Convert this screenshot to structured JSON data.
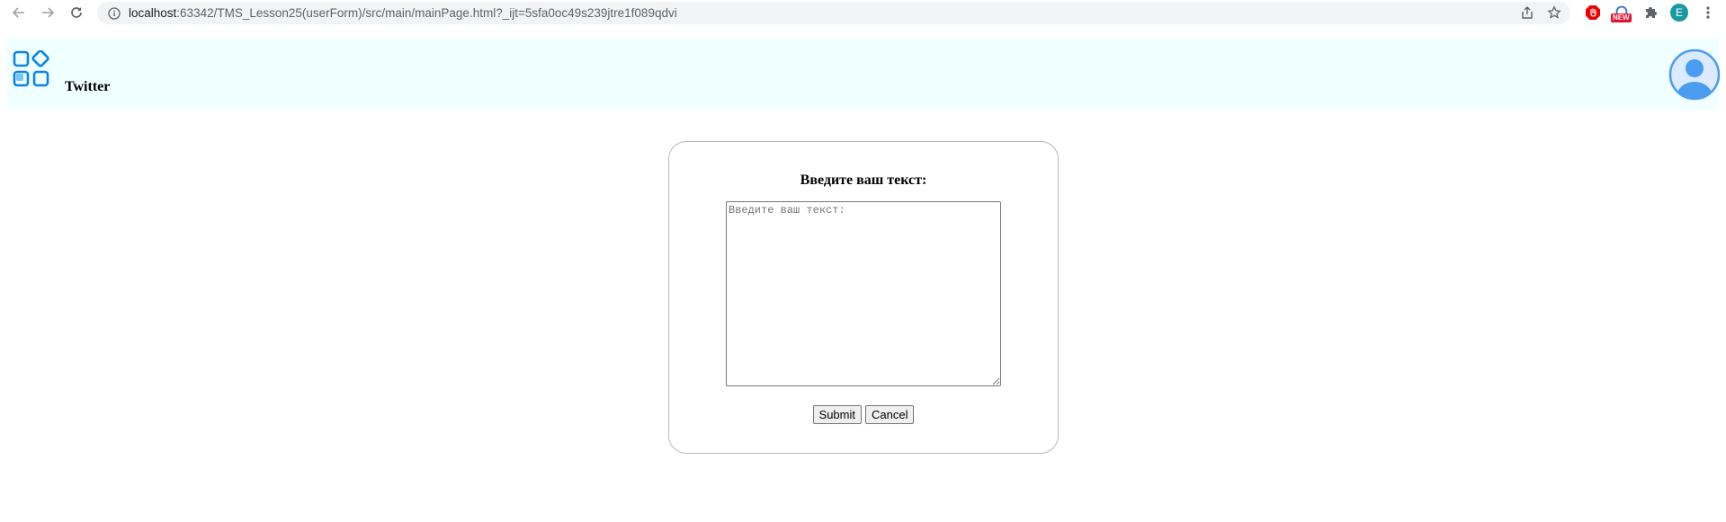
{
  "browser": {
    "url_host": "localhost",
    "url_path": ":63342/TMS_Lesson25(userForm)/src/main/mainPage.html?_ijt=5sfa0oc49s239jtre1f089qdvi",
    "new_badge": "NEW",
    "profile_initial": "E"
  },
  "header": {
    "title": "Twitter"
  },
  "form": {
    "heading": "Введите ваш текст:",
    "placeholder": "Введите ваш текст:",
    "submit_label": "Submit",
    "cancel_label": "Cancel"
  },
  "colors": {
    "header_bg": "#f0ffff",
    "logo_accent": "#0a84e8",
    "profile_accent": "#4a9cf0"
  }
}
